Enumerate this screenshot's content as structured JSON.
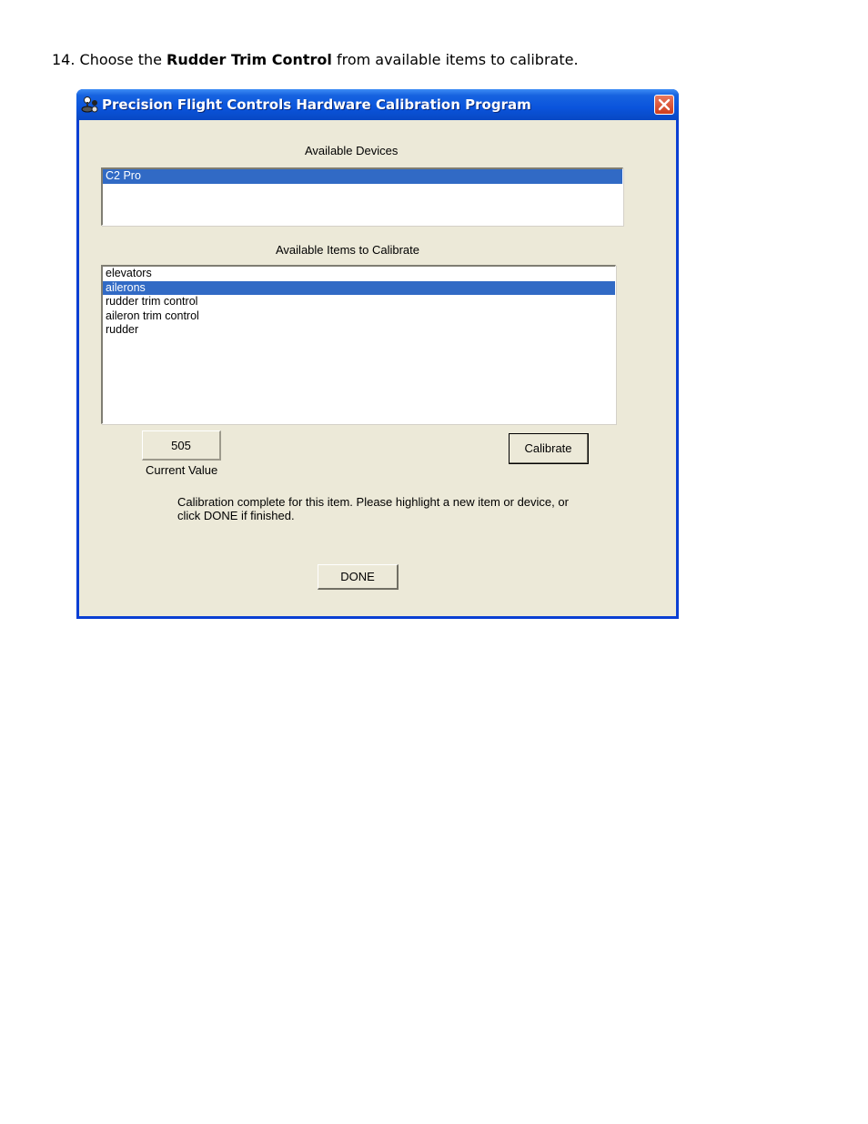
{
  "instruction": {
    "prefix": "14. Choose the ",
    "bold": "Rudder Trim Control",
    "suffix": " from available items to calibrate."
  },
  "window": {
    "title": "Precision Flight Controls Hardware Calibration Program",
    "app_icon": "joystick-icon",
    "close_icon": "close-icon"
  },
  "devices": {
    "label": "Available Devices",
    "items": [
      "C2 Pro"
    ],
    "selected": "C2 Pro"
  },
  "items_to_calibrate": {
    "label": "Available Items to Calibrate",
    "items": [
      "elevators",
      "ailerons",
      "rudder trim control",
      "aileron trim control",
      "rudder"
    ],
    "selected": "ailerons"
  },
  "current_value": {
    "value": "505",
    "label": "Current Value"
  },
  "calibrate_button": "Calibrate",
  "status_message": "Calibration complete for this item. Please highlight a new item or device, or click DONE if finished.",
  "done_button": "DONE",
  "colors": {
    "selection": "#316ac5",
    "dialog_bg": "#ece9d8",
    "titlebar": "#0a54dc"
  }
}
